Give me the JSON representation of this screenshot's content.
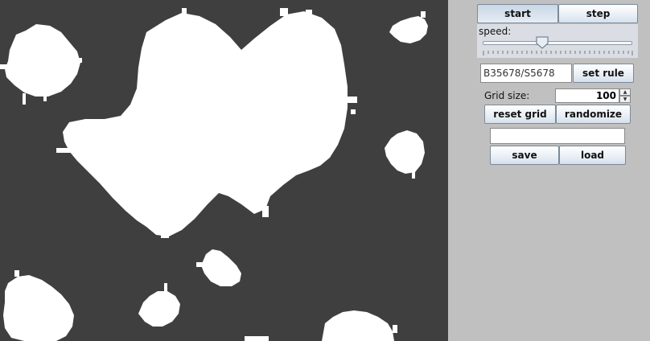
{
  "controls": {
    "start_label": "start",
    "step_label": "step",
    "speed_label": "speed:",
    "speed_value": 0.4,
    "rule_value": "B35678/S5678",
    "set_rule_label": "set rule",
    "grid_size_label": "Grid size:",
    "grid_size_value": "100",
    "reset_grid_label": "reset grid",
    "randomize_label": "randomize",
    "file_value": "",
    "save_label": "save",
    "load_label": "load"
  },
  "colors": {
    "dead_cell": "#3f3f3f",
    "live_cell": "#ffffff",
    "panel": "#c0c0c0"
  },
  "icons": {
    "spin_up": "triangle-up",
    "spin_down": "triangle-down"
  }
}
